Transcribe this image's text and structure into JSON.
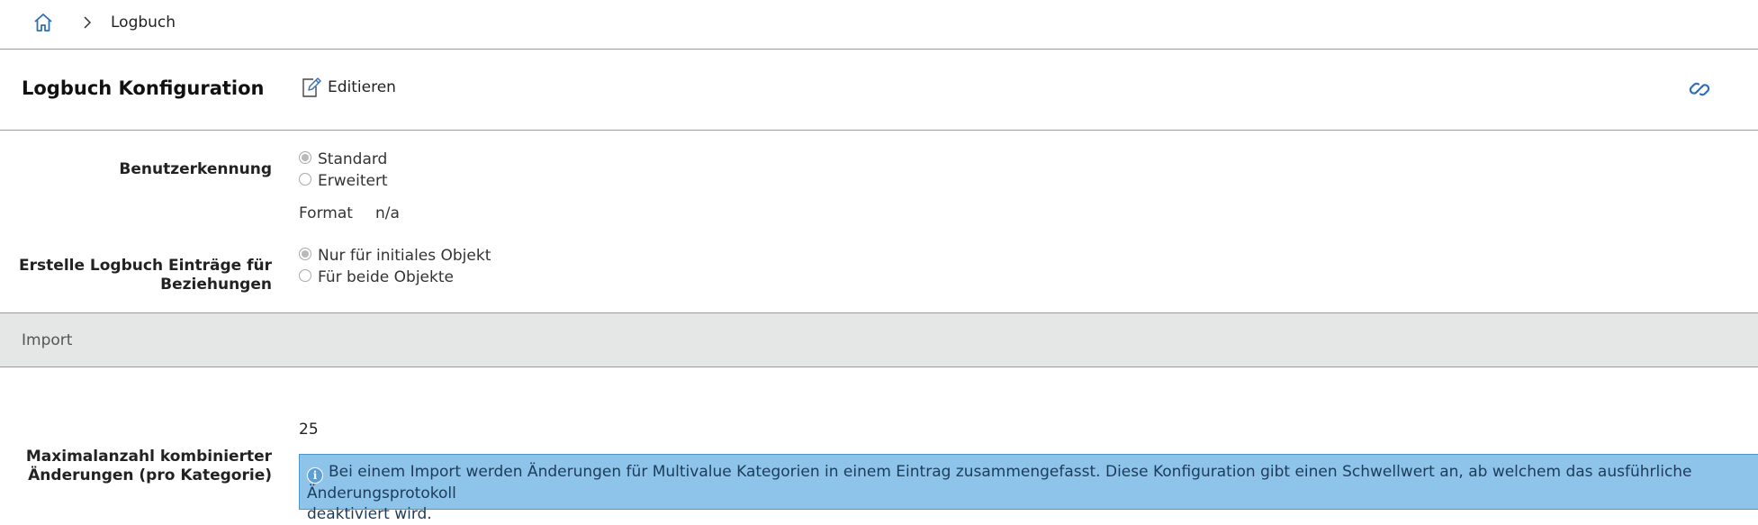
{
  "breadcrumb": {
    "home_icon": "home-icon",
    "separator_icon": "chevron-right-icon",
    "current": "Logbuch"
  },
  "header": {
    "title": "Logbuch Konfiguration",
    "edit_label": "Editieren",
    "edit_icon": "edit-icon",
    "link_icon": "link-icon"
  },
  "form": {
    "user_recognition": {
      "label": "Benutzerkennung",
      "options": [
        {
          "label": "Standard",
          "checked": true
        },
        {
          "label": "Erweitert",
          "checked": false
        }
      ],
      "format_label": "Format",
      "format_value": "n/a"
    },
    "relations": {
      "label_line1": "Erstelle Logbuch Einträge für",
      "label_line2": "Beziehungen",
      "options": [
        {
          "label": "Nur für initiales Objekt",
          "checked": true
        },
        {
          "label": "Für beide Objekte",
          "checked": false
        }
      ]
    }
  },
  "import_section": {
    "title": "Import",
    "max_changes": {
      "label_line1": "Maximalanzahl kombinierter",
      "label_line2": "Änderungen (pro Kategorie)",
      "value": "25"
    },
    "info_text_line1": "Bei einem Import werden Änderungen für Multivalue Kategorien in einem Eintrag zusammengefasst. Diese Konfiguration gibt einen Schwellwert an, ab welchem das ausführliche Änderungsprotokoll",
    "info_text_line2": "deaktiviert wird."
  },
  "colors": {
    "accent": "#2f6fb5",
    "info_bg": "#8ec4ea",
    "section_bg": "#e5e7e6"
  }
}
